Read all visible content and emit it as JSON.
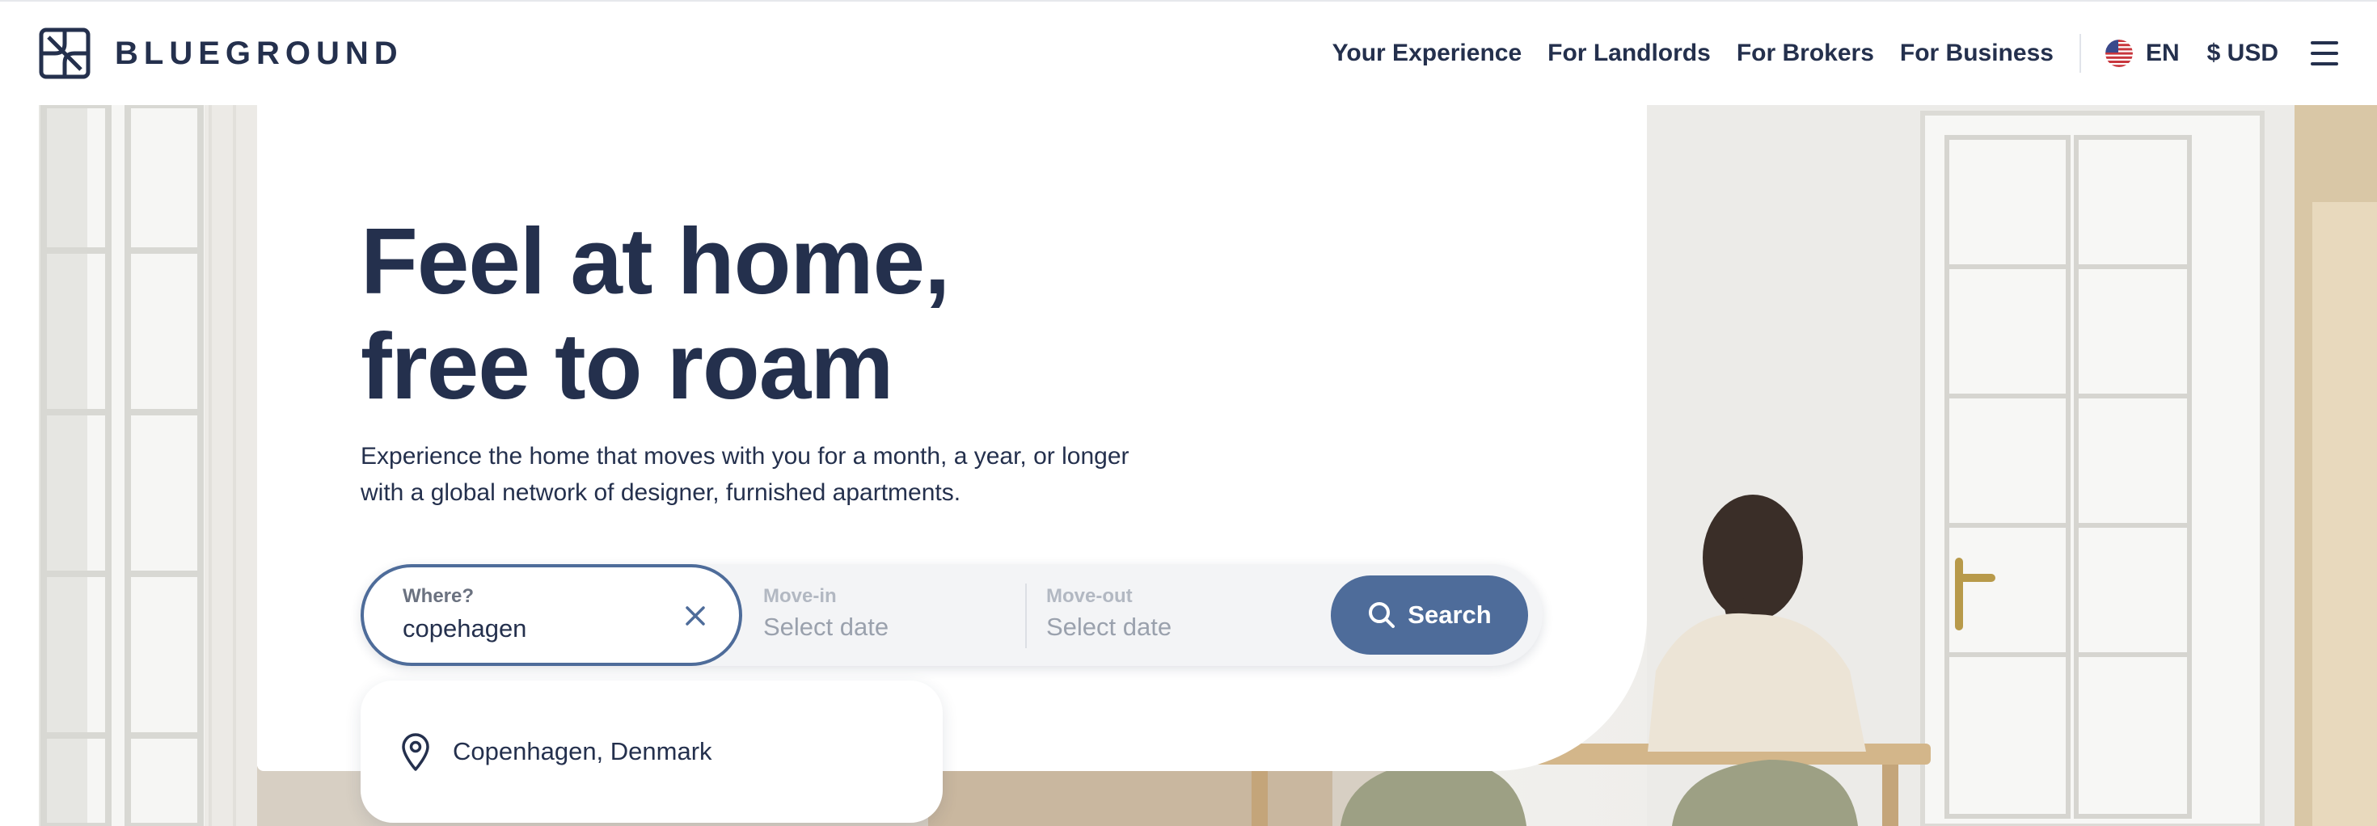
{
  "brand": {
    "name": "BLUEGROUND"
  },
  "nav": {
    "items": [
      {
        "label": "Your Experience"
      },
      {
        "label": "For Landlords"
      },
      {
        "label": "For Brokers"
      },
      {
        "label": "For Business"
      }
    ],
    "language": "EN",
    "currency": "$ USD",
    "menu_icon": "hamburger-menu-icon"
  },
  "hero": {
    "headline_line1": "Feel at home,",
    "headline_line2": "free to roam",
    "subtext_line1": "Experience the home that moves with you for a month, a year, or longer",
    "subtext_line2": "with a global network of designer, furnished apartments."
  },
  "search": {
    "where_label": "Where?",
    "where_value": "copehagen",
    "movein_label": "Move-in",
    "movein_placeholder": "Select date",
    "moveout_label": "Move-out",
    "moveout_placeholder": "Select date",
    "button_label": "Search"
  },
  "suggestions": [
    {
      "label": "Copenhagen, Denmark",
      "icon": "location-pin-icon"
    }
  ],
  "colors": {
    "brand_navy": "#24304d",
    "accent_blue": "#4e6c9a"
  }
}
